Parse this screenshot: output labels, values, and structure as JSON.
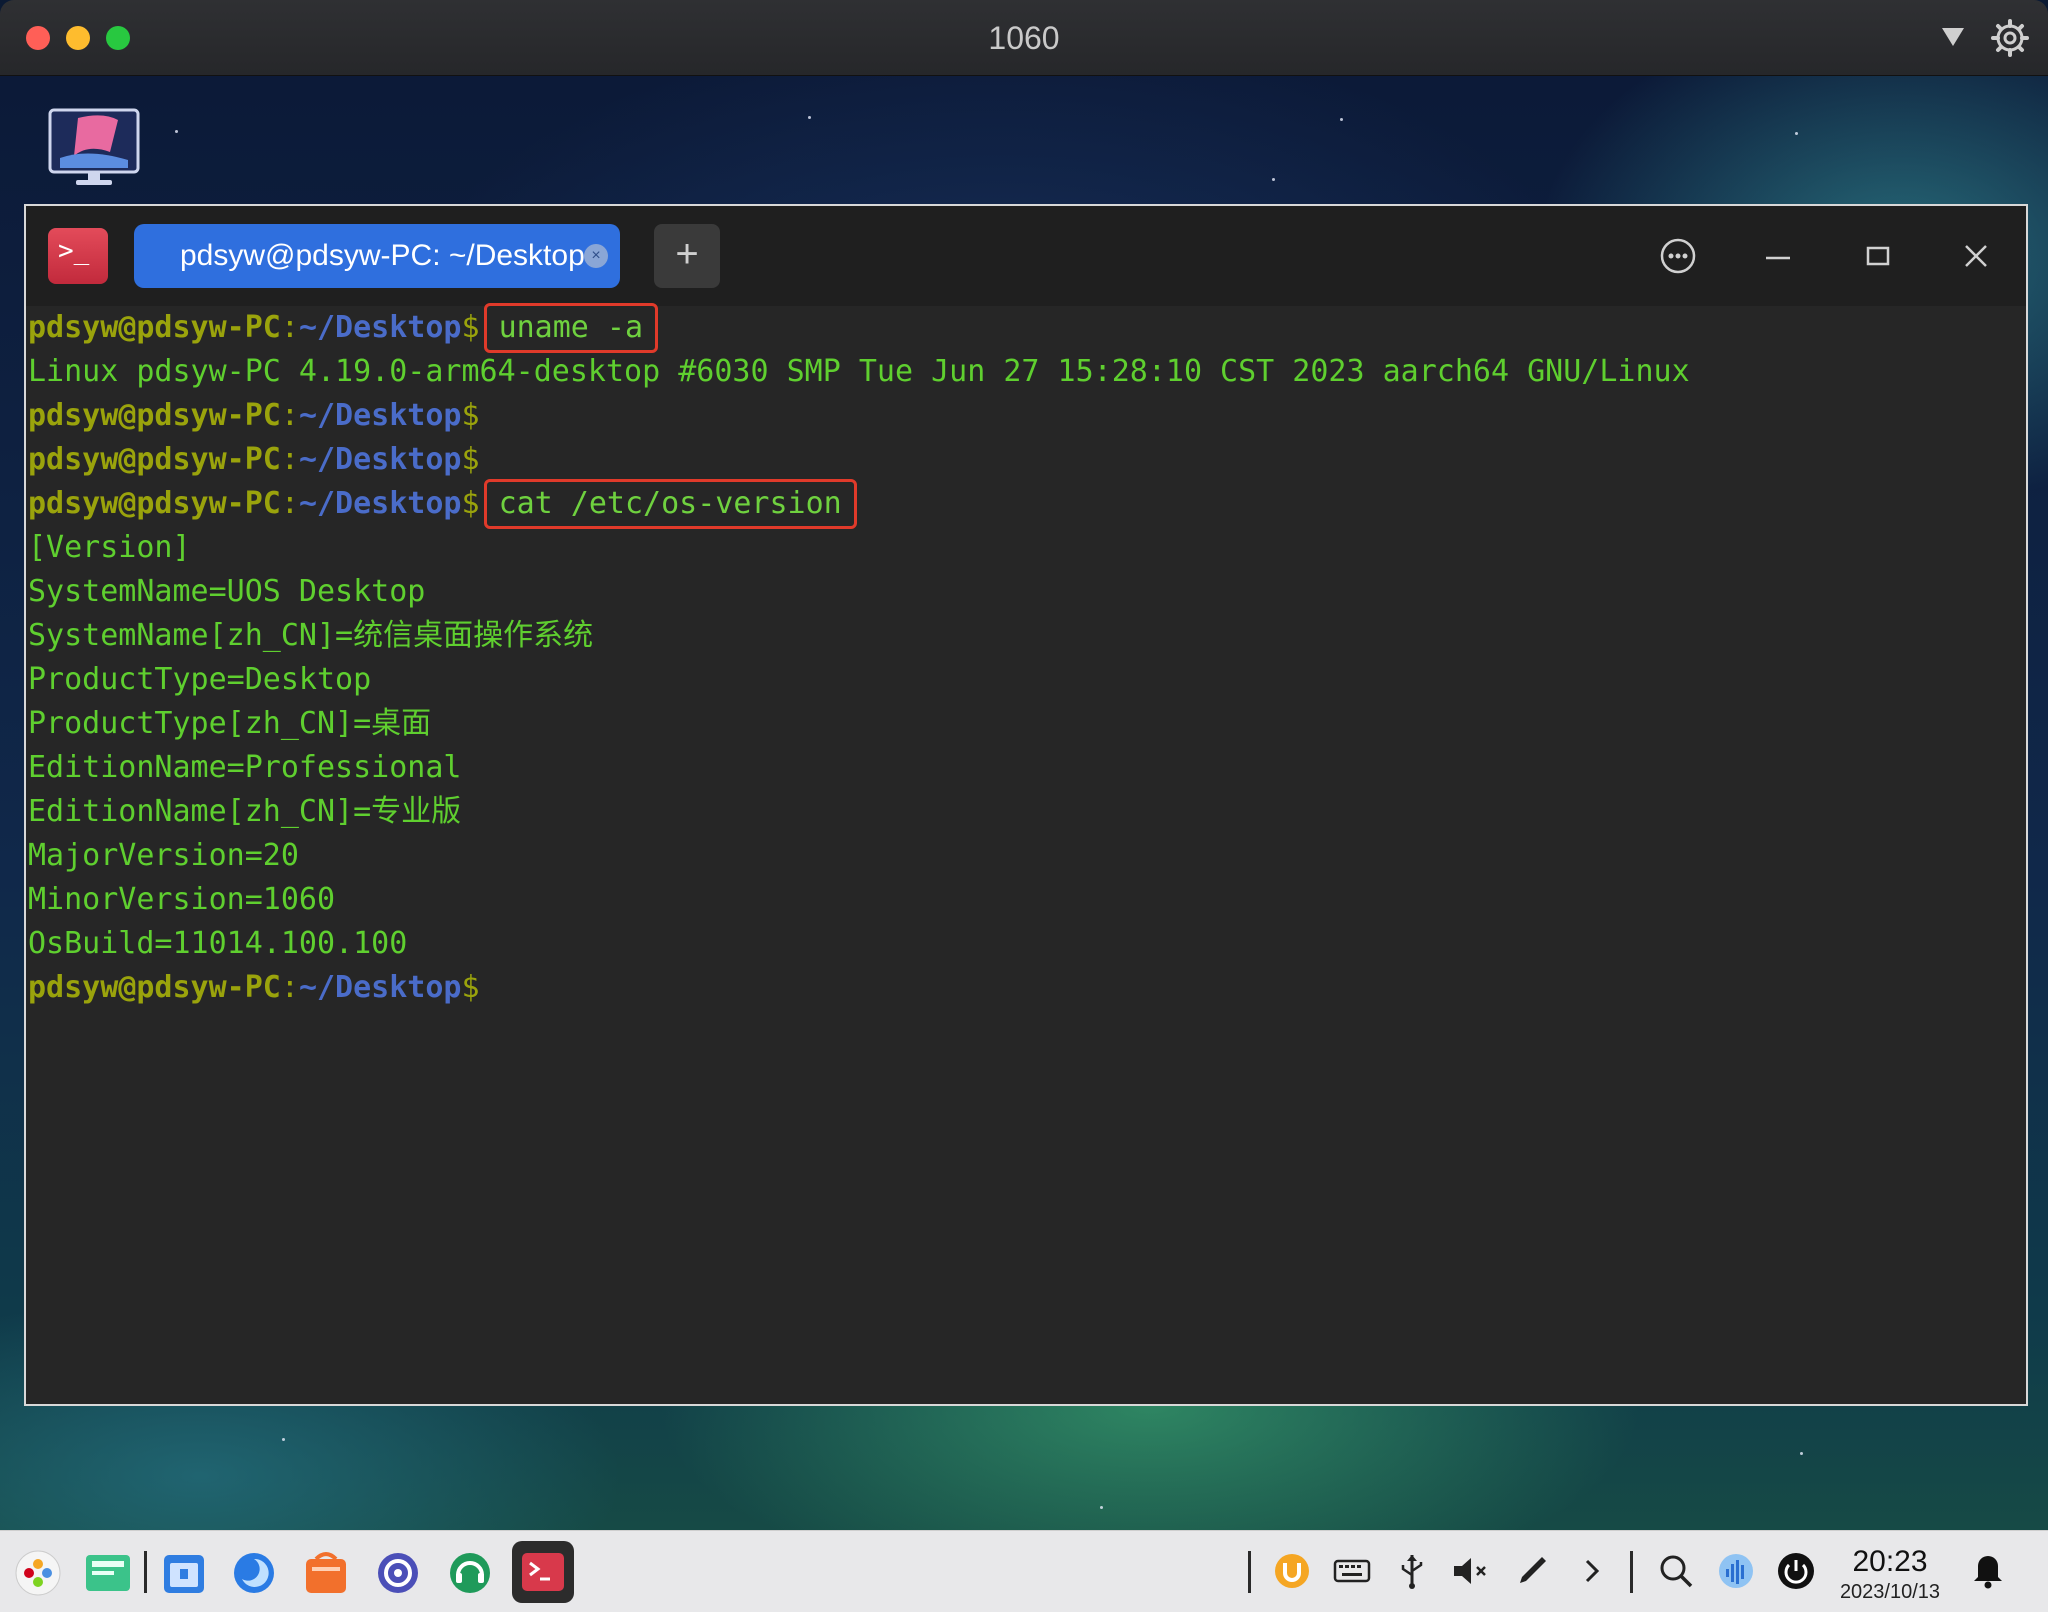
{
  "vm_window": {
    "title": "1060"
  },
  "terminal": {
    "tab_title": "pdsyw@pdsyw-PC: ~/Desktop",
    "tab_close": "×",
    "new_tab": "+",
    "app_icon_text": ">_",
    "prompt": {
      "user_host": "pdsyw@pdsyw-PC",
      "colon": ":",
      "path": "~/Desktop",
      "dollar": "$"
    },
    "commands": {
      "uname": "uname -a",
      "cat": "cat /etc/os-version"
    },
    "output": {
      "uname": "Linux pdsyw-PC 4.19.0-arm64-desktop #6030 SMP Tue Jun 27 15:28:10 CST 2023 aarch64 GNU/Linux",
      "os_version": [
        "[Version]",
        "SystemName=UOS Desktop",
        "SystemName[zh_CN]=统信桌面操作系统",
        "ProductType=Desktop",
        "ProductType[zh_CN]=桌面",
        "EditionName=Professional",
        "EditionName[zh_CN]=专业版",
        "MajorVersion=20",
        "MinorVersion=1060",
        "OsBuild=11014.100.100"
      ]
    }
  },
  "taskbar": {
    "time": "20:23",
    "date": "2023/10/13",
    "launcher_icons": [
      "launcher-icon",
      "multitask-icon",
      "file-manager-icon",
      "browser-icon",
      "app-store-icon",
      "control-center-icon",
      "support-icon",
      "terminal-icon"
    ],
    "tray_icons": [
      "uos-id-icon",
      "keyboard-icon",
      "usb-icon",
      "volume-muted-icon",
      "pen-icon",
      "expand-tray-icon",
      "search-icon",
      "network-icon",
      "power-icon",
      "notification-icon"
    ]
  },
  "colors": {
    "terminal_bg": "#262626",
    "output_green": "#5fcf2f",
    "prompt_user": "#9aa30c",
    "prompt_path": "#4a6cc9",
    "highlight_box": "#e03a2a",
    "tab_active": "#2f6fde"
  }
}
